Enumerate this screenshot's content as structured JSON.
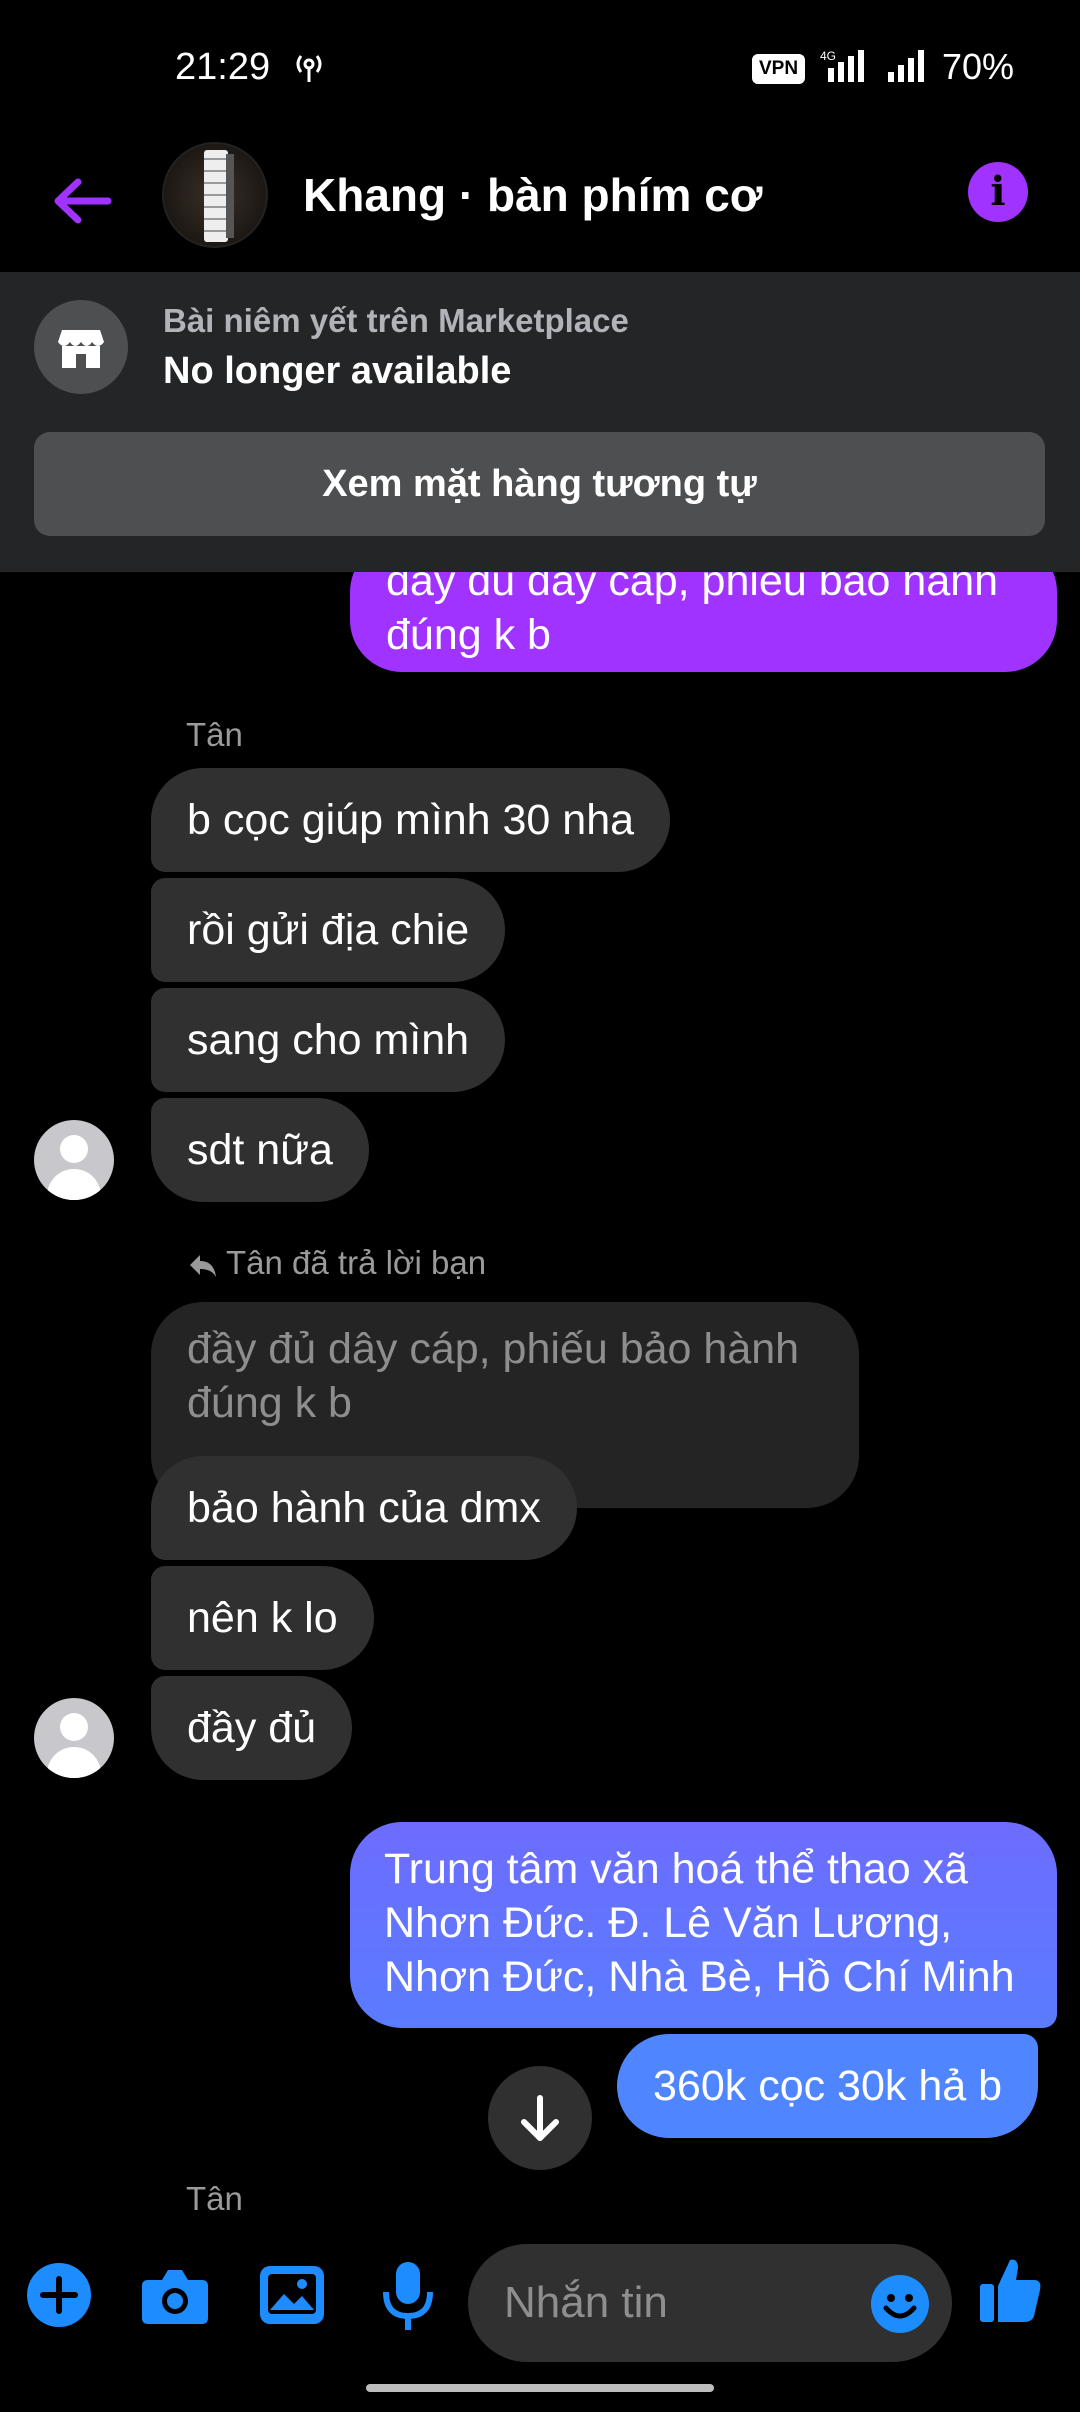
{
  "status_bar": {
    "time": "21:29",
    "vpn": "VPN",
    "network": "4G",
    "battery": "70%"
  },
  "header": {
    "title": "Khang · bàn phím cơ"
  },
  "banner": {
    "subtitle": "Bài niêm yết trên Marketplace",
    "title": "No longer available",
    "button": "Xem mặt hàng tương tự"
  },
  "messages": {
    "out_top_partial_line1": "đầy đủ dây cáp, phiếu bảo hành",
    "out_top_partial_line2": "đúng k b",
    "sender1": "Tân",
    "in1": "b cọc giúp mình 30 nha",
    "in2": "rồi gửi địa chie",
    "in3": "sang cho mình",
    "in4": "sdt nữa",
    "reply_note": "Tân đã trả lời bạn",
    "quoted_line1": "đầy đủ dây cáp, phiếu bảo hành",
    "quoted_line2": "đúng k b",
    "in5": "bảo hành của dmx",
    "in6": "nên k lo",
    "in7": "đầy đủ",
    "out1_line1": "Trung tâm văn hoá thể thao xã",
    "out1_line2": "Nhơn Đức.  Đ. Lê Văn Lương,",
    "out1_line3": "Nhơn Đức, Nhà Bè, Hồ Chí Minh",
    "out2": "360k cọc 30k hả b",
    "sender2": "Tân"
  },
  "composer": {
    "placeholder": "Nhắn tin"
  },
  "colors": {
    "accent": "#a033ff",
    "blue_top": "#6d6cff",
    "blue_bottom": "#4f86ff",
    "incoming": "#303030"
  },
  "icons": [
    "hotspot-icon",
    "signal-icon",
    "back-arrow-icon",
    "info-icon",
    "store-icon",
    "arrow-down-icon",
    "plus-icon",
    "camera-icon",
    "gallery-icon",
    "mic-icon",
    "emoji-icon",
    "thumbs-up-icon"
  ]
}
